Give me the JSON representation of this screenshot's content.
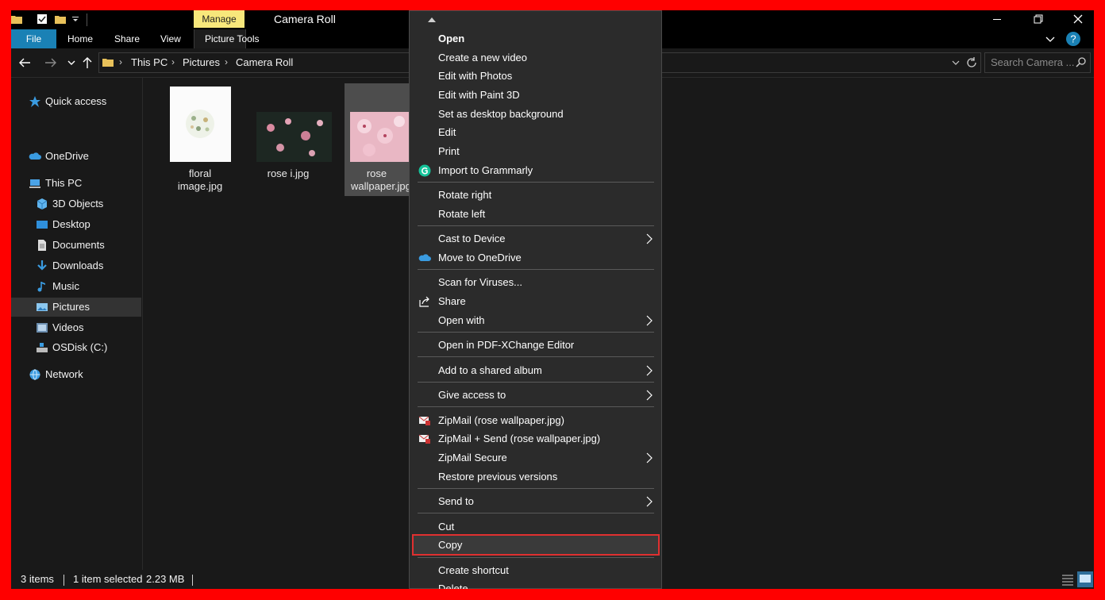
{
  "colors": {
    "accent": "#1a81b5",
    "contextual": "#f7e77b",
    "highlight": "#e03030",
    "frame": "#ff0000"
  },
  "window": {
    "title": "Camera Roll",
    "manage_tab": "Manage"
  },
  "ribbon": {
    "tabs": [
      "File",
      "Home",
      "Share",
      "View",
      "Picture Tools"
    ]
  },
  "address": {
    "crumbs": [
      "This PC",
      "Pictures",
      "Camera Roll"
    ],
    "search_placeholder": "Search Camera ..."
  },
  "nav": {
    "items": [
      "Quick access",
      "OneDrive",
      "This PC",
      "3D Objects",
      "Desktop",
      "Documents",
      "Downloads",
      "Music",
      "Pictures",
      "Videos",
      "OSDisk (C:)",
      "Network"
    ],
    "selected": "Pictures"
  },
  "files": [
    {
      "name": "floral image.jpg",
      "selected": false
    },
    {
      "name": "rose i.jpg",
      "selected": false
    },
    {
      "name_line1": "rose",
      "name_line2": "wallpaper.jpg",
      "selected": true
    }
  ],
  "status": {
    "items": "3 items",
    "selection": "1 item selected",
    "size": "2.23 MB"
  },
  "context_menu": {
    "items": [
      {
        "label": "Open",
        "bold": true
      },
      {
        "label": "Create a new video"
      },
      {
        "label": "Edit with Photos"
      },
      {
        "label": "Edit with Paint 3D"
      },
      {
        "label": "Set as desktop background"
      },
      {
        "label": "Edit"
      },
      {
        "label": "Print"
      },
      {
        "label": "Import to Grammarly",
        "icon": "grammarly-icon"
      },
      {
        "label": "Rotate right"
      },
      {
        "label": "Rotate left"
      },
      {
        "label": "Cast to Device",
        "submenu": true
      },
      {
        "label": "Move to OneDrive",
        "icon": "onedrive-icon"
      },
      {
        "label": "Scan for Viruses..."
      },
      {
        "label": "Share",
        "icon": "share-icon"
      },
      {
        "label": "Open with",
        "submenu": true
      },
      {
        "label": "Open in PDF-XChange Editor"
      },
      {
        "label": "Add to a shared album",
        "submenu": true
      },
      {
        "label": "Give access to",
        "submenu": true
      },
      {
        "label": "ZipMail (rose wallpaper.jpg)",
        "icon": "zipmail-icon"
      },
      {
        "label": "ZipMail + Send (rose wallpaper.jpg)",
        "icon": "zipmail-icon"
      },
      {
        "label": "ZipMail Secure",
        "submenu": true
      },
      {
        "label": "Restore previous versions"
      },
      {
        "label": "Send to",
        "submenu": true
      },
      {
        "label": "Cut"
      },
      {
        "label": "Copy",
        "highlighted": true
      },
      {
        "label": "Create shortcut"
      },
      {
        "label": "Delete"
      }
    ]
  }
}
